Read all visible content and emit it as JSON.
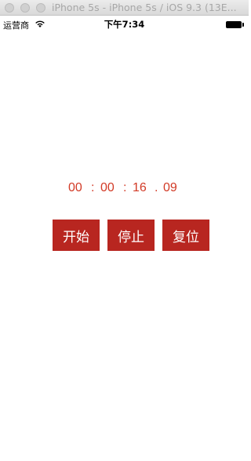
{
  "window": {
    "title": "iPhone 5s - iPhone 5s / iOS 9.3 (13E..."
  },
  "status_bar": {
    "carrier": "运营商",
    "time": "下午7:34",
    "icons": [
      "wifi-icon",
      "battery-icon"
    ]
  },
  "stopwatch": {
    "hours": "00",
    "sep1": ":",
    "minutes": "00",
    "sep2": ":",
    "seconds": "16",
    "sep3": ".",
    "hundredths": "09",
    "color": "#d23a26"
  },
  "buttons": {
    "start_label": "开始",
    "stop_label": "停止",
    "reset_label": "复位",
    "color": "#b82620"
  }
}
